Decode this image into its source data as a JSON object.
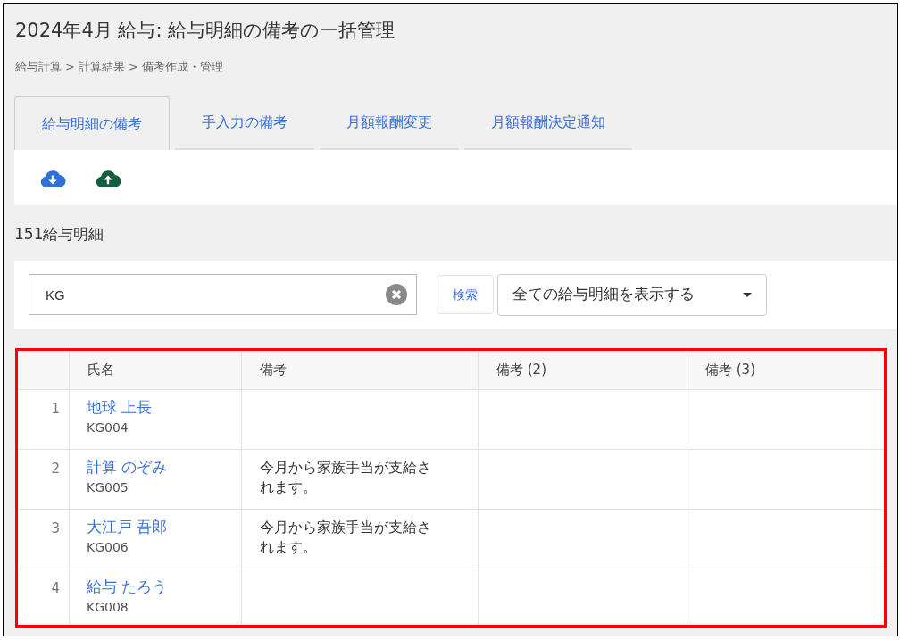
{
  "page_title": "2024年4月 給与: 給与明細の備考の一括管理",
  "breadcrumb": [
    "給与計算",
    "計算結果",
    "備考作成・管理"
  ],
  "breadcrumb_separator": ">",
  "tabs": [
    {
      "label": "給与明細の備考",
      "selected": true
    },
    {
      "label": "手入力の備考",
      "selected": false
    },
    {
      "label": "月額報酬変更",
      "selected": false
    },
    {
      "label": "月額報酬決定通知",
      "selected": false
    }
  ],
  "toolbar": [
    {
      "kind": "download"
    },
    {
      "kind": "upload"
    }
  ],
  "count_label": "151給与明細",
  "search": {
    "value": "KG",
    "button": "検索"
  },
  "filter": {
    "value": "全ての給与明細を表示する"
  },
  "table": {
    "columns": [
      "",
      "氏名",
      "備考",
      "備考 (2)",
      "備考 (3)"
    ],
    "rows": [
      {
        "number": "1",
        "name": "地球 上長",
        "code": "KG004",
        "note": "",
        "note_2": "",
        "note_3": ""
      },
      {
        "number": "2",
        "name": "計算 のぞみ",
        "code": "KG005",
        "note": "今月から家族手当が支給されます。",
        "note_2": "",
        "note_3": ""
      },
      {
        "number": "3",
        "name": "大江戸 吾郎",
        "code": "KG006",
        "note": "今月から家族手当が支給されます。",
        "note_2": "",
        "note_3": ""
      },
      {
        "number": "4",
        "name": "給与 たろう",
        "code": "KG008",
        "note": "",
        "note_2": "",
        "note_3": ""
      }
    ]
  }
}
